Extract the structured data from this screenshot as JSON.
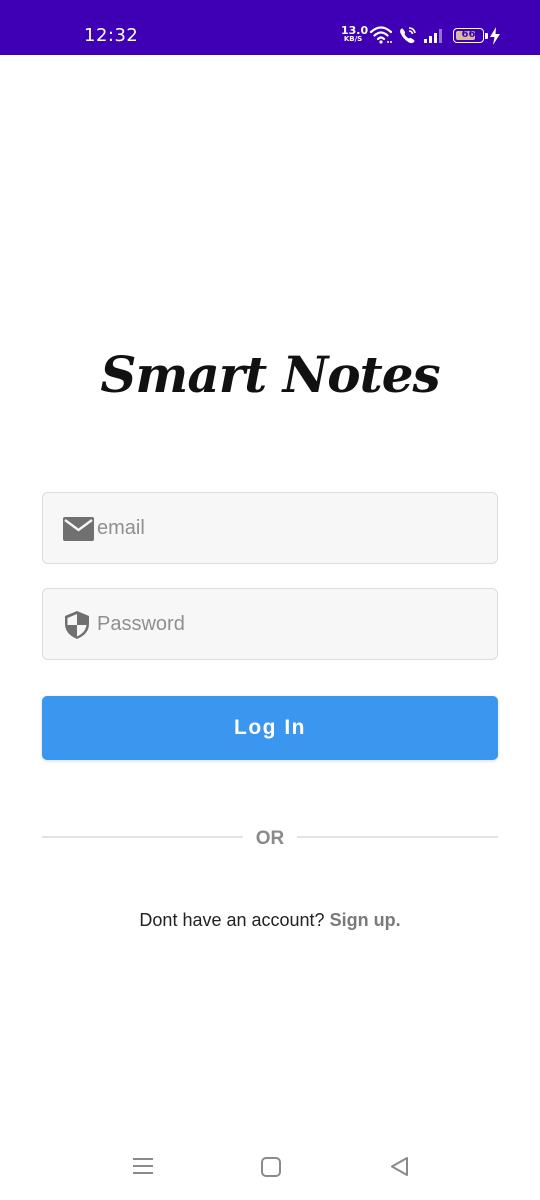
{
  "status_bar": {
    "time": "12:32",
    "net_speed_value": "13.0",
    "net_speed_unit": "KB/S",
    "battery_level": "66",
    "background": "#3f00b5"
  },
  "app": {
    "logo_text": "Smart Notes"
  },
  "form": {
    "email_placeholder": "email",
    "email_icon": "mail-icon",
    "password_placeholder": "Password",
    "password_icon": "shield-icon",
    "login_label": "Log In",
    "button_color": "#3b96f0"
  },
  "divider": {
    "text": "OR"
  },
  "signup": {
    "prompt": "Dont have an account?",
    "link": "Sign up."
  },
  "nav_bar": {
    "icons": [
      "menu-icon",
      "home-icon",
      "back-icon"
    ]
  }
}
